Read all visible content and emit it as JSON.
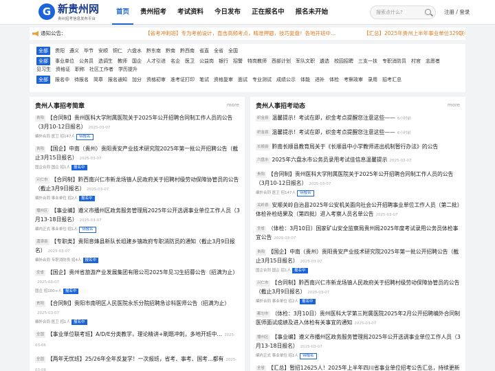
{
  "brand": {
    "mark": "G",
    "title": "新贵州网",
    "subtitle": "贵州招考信息发布平台",
    "accent": "#1a63d8"
  },
  "nav": [
    "首页",
    "贵州招考",
    "考试资料",
    "今日发布",
    "正在报名中",
    "报名未开始"
  ],
  "search": {
    "placeholder": "搜索点什么?"
  },
  "user": {
    "register": "注册",
    "sep": "/",
    "login": "登录"
  },
  "notice": {
    "label": "通知公告:",
    "text": "【省考冲刺班】专为考前设计，直击高频考点，精准押题，技巧复盘！各地开班中…",
    "text2": "【汇总】2025年贵州上半年事业单位329联考招考公告，持"
  },
  "filters": [
    [
      "全部",
      "贵阳",
      "遵义",
      "毕节",
      "安顺",
      "铜仁",
      "六盘水",
      "黔东南",
      "黔南",
      "黔西南",
      "省直",
      "全省",
      "全国"
    ],
    [
      "全部",
      "事业单位",
      "公务员",
      "选调生",
      "教师",
      "国企",
      "人才引进",
      "名企",
      "医卫",
      "公益岗",
      "银行",
      "招警",
      "特岗教师",
      "西部计划",
      "军队文职",
      "遴选",
      "校园招聘",
      "三支一扶",
      "专职消防员",
      "村官",
      "志愿者",
      "见习生",
      "资格证",
      "职称",
      "社区工作者",
      "学历提升"
    ],
    [
      "全部",
      "报名中",
      "待报名",
      "简章",
      "报名通知",
      "加分",
      "资格初审",
      "准考证打印",
      "笔试",
      "资格复审",
      "面试",
      "专业测试",
      "成绩公示",
      "体能",
      "进补",
      "体检",
      "考察政审",
      "录用",
      "招考汇总"
    ]
  ],
  "left": {
    "title": "贵州人事招考简章",
    "more": "more",
    "items": [
      {
        "tag": "贵阳",
        "title": "【合同制】贵州医科大学附属医院关于2025年公开招聘合同制工作人员的公告（3月10-12日报名）",
        "date": "2025-03-07",
        "meta": "编外合同 医卫 招147人",
        "badge": "待报名",
        "outline": true
      },
      {
        "tag": "贵阳",
        "title": "【国企】中南（贵州）贵阳贵安产业技术研究院2025年第一批公开招聘公告（截止3月15日报名）",
        "date": "2025-03-07",
        "meta": "国企合同 国企 招1人",
        "badge": "报名中",
        "outline": false
      },
      {
        "tag": "兴仁市",
        "title": "【合同制】黔西南兴仁市新龙场镇人民政府关于招聘村级劳动保障协管员的公告（截止3月9日报名）",
        "date": "2025-03-07",
        "meta": "编外合同 事业单位 招2人",
        "badge": "报名中",
        "outline": false
      },
      {
        "tag": "播州区",
        "title": "【事业编】遵义市播州区政务服务管理局2025年公开选调事业单位工作人员（3月13-18日报名）",
        "date": "2025-03-07",
        "meta": "编内正式 事业单位 招1人",
        "badge": "待报名",
        "outline": true
      },
      {
        "tag": "湄潭县",
        "title": "【专职类】贵阳息烽县新队长组建乡镇政府专职消防员的通知（截止3月9日报名）",
        "date": "2025-03-07",
        "meta": "编外合同 专职消防员 招4人",
        "badge": "报名中",
        "outline": false
      },
      {
        "tag": "全省",
        "title": "【国企】贵州省旅游产业发展集团有限公司2025年见习生招募公告（招满为止）",
        "date": "2025-03-07",
        "meta": "国企 招100+人",
        "badge": "报名中",
        "outline": false
      },
      {
        "tag": "贵阳",
        "title": "【合同制】贵阳市南明区人民医院永乐分院招聘急诊科医师公告（招满为止）",
        "date": "2025-03-07",
        "meta": "编外合同 医卫 招1人",
        "badge": "报名中",
        "outline": false
      },
      {
        "tag": "全国",
        "title": "【事业单位联考班】A/D/E分类教学，理论精讲+刷题冲刺，多地开班中…",
        "date": "2025-03-06",
        "meta": "",
        "badge": "",
        "outline": false
      },
      {
        "tag": "全国",
        "title": "【两年无忧班】25/26年全年反复学！一次报班，省考、事考、国考…都有",
        "date": "2025-03-06",
        "meta": "",
        "badge": "",
        "outline": false
      }
    ]
  },
  "right": {
    "title": "贵州人事招考动态",
    "more": "more",
    "items": [
      {
        "tag": "织金县",
        "title": "温馨提示！考试在即，织金考点提醒您注意这些——",
        "date": "6小时前",
        "meta": "",
        "badge": "",
        "outline": false
      },
      {
        "tag": "织金县",
        "title": "温馨提示！考试在即，织金考点提醒您注意这些——",
        "date": "6小时前",
        "meta": "",
        "badge": "",
        "outline": false
      },
      {
        "tag": "长顺县",
        "title": "黔南长顺县教育局关于《长顺县中小学教师进出机制暂行办法》的公告",
        "date": "",
        "meta": "",
        "badge": "",
        "outline": false
      },
      {
        "tag": "六盘水",
        "title": "2025年六盘水市公务员录用考试佳信息温馨提示",
        "date": "2025-03-07",
        "meta": "",
        "badge": "",
        "outline": false
      },
      {
        "tag": "贵阳",
        "title": "【合同制】贵州医科大学附属医院关于2025年公开招聘合同制工作人员的公告（3月10-12日报名）",
        "date": "2025-03-07",
        "meta": "编外合同 医卫 招147人",
        "badge": "待报名",
        "outline": true
      },
      {
        "tag": "关岭县",
        "title": "安顺关岭自治县2025年公安机关面向社会公开招聘事业单位工作人员（第二批）体检补检结果及（第四批）进入考察人员名单公告",
        "date": "2025-03-07",
        "meta": "",
        "badge": "",
        "outline": false
      },
      {
        "tag": "全省",
        "title": "（体检：3月10日）国家矿山安全监察局贵州局2025年度考试录用公务员体检事宜公告",
        "date": "2025-03-07",
        "meta": "",
        "badge": "",
        "outline": false
      },
      {
        "tag": "贵阳",
        "title": "【国企】中南（贵州）贵阳贵安产业技术研究院2025年第一批公开招聘公告（截止3月15日报名）",
        "date": "2025-03-07",
        "meta": "国企合同 国企 招1人",
        "badge": "报名中",
        "outline": false
      },
      {
        "tag": "兴仁市",
        "title": "【合同制】黔西南兴仁市新龙场镇人民政府关于招聘村级劳动保障协管员的公告（截止3月9日报名）",
        "date": "2025-03-07",
        "meta": "编外合同 事业单位 招2人",
        "badge": "报名中",
        "outline": false
      },
      {
        "tag": "都匀市",
        "title": "（体检：3月10日）贵州医科大学第三附属医院2025年2月公开招聘编外合同制医师面试成绩及进入体检有关事宜的通知",
        "date": "2025-03-07",
        "meta": "",
        "badge": "",
        "outline": false
      },
      {
        "tag": "播州区",
        "title": "【事业编】遵义市播州区政务服务管理局2025年公开选调事业单位工作人员（3月13-18日报名）",
        "date": "2025-03-07",
        "meta": "编内正式 事业单位 招1人",
        "badge": "待报名",
        "outline": true
      },
      {
        "tag": "全省",
        "title": "【汇总】暂招12625人！2025年上半年四川省事业单位招考公告汇总，持续更新中…",
        "date": "2025-03-07",
        "meta": "",
        "badge": "",
        "outline": false
      }
    ]
  }
}
